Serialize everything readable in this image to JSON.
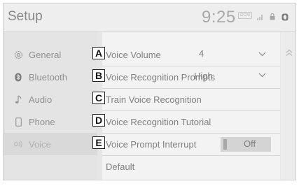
{
  "header": {
    "title": "Setup",
    "clock": "9:25",
    "status_badge": "DCM"
  },
  "sidebar": {
    "items": [
      {
        "label": "General",
        "icon": "gear-icon"
      },
      {
        "label": "Bluetooth",
        "icon": "bluetooth-icon"
      },
      {
        "label": "Audio",
        "icon": "music-note-icon"
      },
      {
        "label": "Phone",
        "icon": "phone-icon"
      },
      {
        "label": "Voice",
        "icon": "voice-icon",
        "active": true
      }
    ]
  },
  "settings": {
    "rows": [
      {
        "marker": "A",
        "label": "Voice Volume",
        "value": "4"
      },
      {
        "marker": "B",
        "label": "Voice Recognition Prompts",
        "value": "High"
      },
      {
        "marker": "C",
        "label": "Train Voice Recognition"
      },
      {
        "marker": "D",
        "label": "Voice Recognition Tutorial"
      },
      {
        "marker": "E",
        "label": "Voice Prompt Interrupt",
        "value": "Off"
      },
      {
        "label": "Default"
      }
    ]
  },
  "colors": {
    "background": "#e6e6e6",
    "panel": "#f3f3f3",
    "text": "#808080",
    "marker_border": "#222222"
  }
}
